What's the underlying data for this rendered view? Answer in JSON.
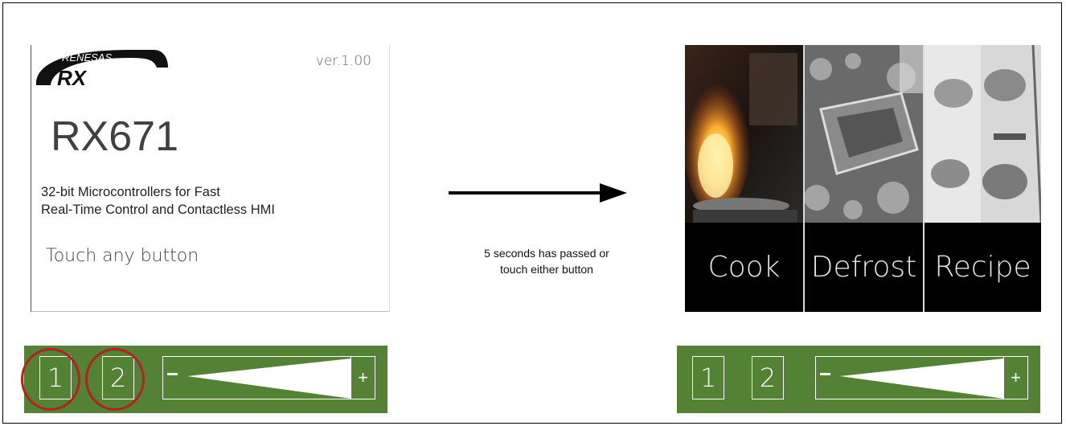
{
  "splash": {
    "logo_top": "RENESAS",
    "logo_bottom": "RX",
    "version": "ver.1.00",
    "model": "RX671",
    "description_line1": "32-bit Microcontrollers for Fast",
    "description_line2": "Real-Time Control and Contactless HMI",
    "prompt": "Touch any button"
  },
  "transition": {
    "caption_line1": "5 seconds has passed or",
    "caption_line2": "touch either button"
  },
  "menu": {
    "items": [
      {
        "label": "Cook"
      },
      {
        "label": "Defrost"
      },
      {
        "label": "Recipe"
      }
    ]
  },
  "button_bar": {
    "button1": "1",
    "button2": "2",
    "slider_minus": "−",
    "slider_plus": "+"
  },
  "colors": {
    "bar_green": "#548235",
    "highlight_red": "#b22222",
    "menu_background": "#000000"
  }
}
